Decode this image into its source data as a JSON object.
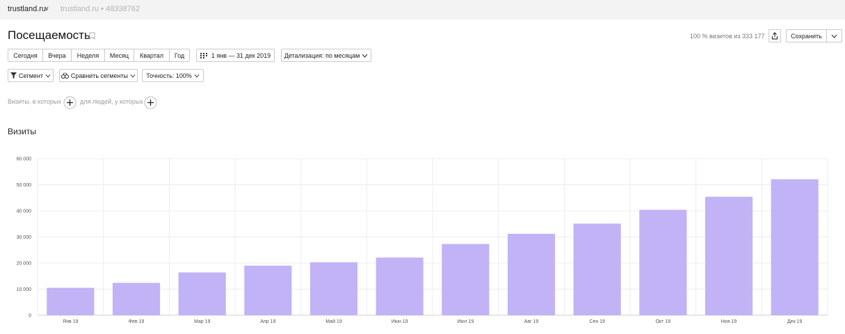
{
  "header": {
    "site": "trustland.ru",
    "counter": "trustland.ru • 48338762"
  },
  "page": {
    "title": "Посещаемость",
    "summary": "100 % визитов из 333 177",
    "save_label": "Сохранить"
  },
  "periods": [
    "Сегодня",
    "Вчера",
    "Неделя",
    "Месяц",
    "Квартал",
    "Год"
  ],
  "date_range": "1 янв — 31 дек 2019",
  "detail": "Детализация: по месяцам",
  "filters": {
    "segment": "Сегмент",
    "compare": "Сравнить сегменты",
    "accuracy": "Точность: 100%"
  },
  "conditions": {
    "visits_label": "Визиты, в которых",
    "people_label": "для людей, у которых"
  },
  "chart_section_title": "Визиты",
  "chart_data": {
    "type": "bar",
    "categories": [
      "Янв 19",
      "Фев 19",
      "Мар 19",
      "Апр 19",
      "Май 19",
      "Июн 19",
      "Июл 19",
      "Авг 19",
      "Сен 19",
      "Окт 19",
      "Ноя 19",
      "Дек 19"
    ],
    "values": [
      10500,
      12400,
      16400,
      19000,
      20300,
      22100,
      27300,
      31200,
      35100,
      40400,
      45400,
      52100
    ],
    "yticks": [
      "0",
      "10 000",
      "20 000",
      "30 000",
      "40 000",
      "50 000",
      "60 000"
    ],
    "ylim": [
      0,
      60000
    ],
    "grid": true,
    "color": "#c2b3f6"
  },
  "colors": {
    "bar": "#c2b3f6",
    "topbar": "#f3f3f3",
    "border": "#c9c9c9"
  }
}
